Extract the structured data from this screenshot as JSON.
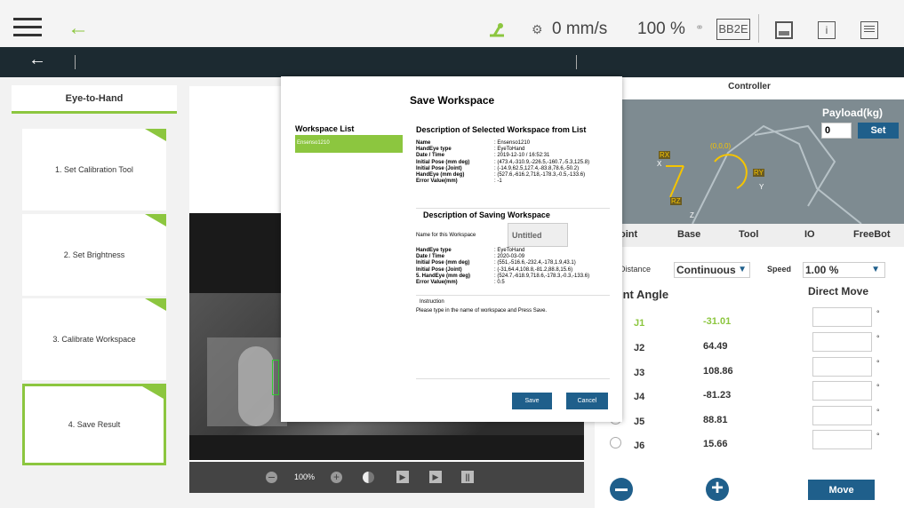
{
  "topbar": {
    "speed": "0 mm/s",
    "percent": "100 %",
    "badge": "BB2E"
  },
  "left_panel": {
    "tab": "Eye-to-Hand",
    "steps": [
      "1. Set Calibration Tool",
      "2. Set Brightness",
      "3. Calibrate Workspace",
      "4. Save Result"
    ]
  },
  "camera": {
    "zoom": "100%"
  },
  "modal": {
    "title": "Save Workspace",
    "list_title": "Workspace List",
    "list_items": [
      "Ensenso1210"
    ],
    "desc_title": "Description of Selected Workspace from List",
    "selected_labels": [
      "Name",
      "HandEye type",
      "Date / Time",
      "Initial Pose (mm deg)",
      "Initial Pose (Joint)",
      "HandEye (mm deg)",
      "Error Value(mm)"
    ],
    "selected_values": [
      ": Ensenso1210",
      ": EyeToHand",
      ": 2019-12-10 / 16:52:31",
      ": (473.4,-310.9,-226.5,-160.7,-5.3,125.8)",
      ": (-14.9,62.5,127.4,-83.8,78.6,-50.2)",
      ": (527.6,-616.2,718,-178.3,-0.5,-133.6)",
      ": -1"
    ],
    "saving_title": "Description of Saving Workspace",
    "name_label": "Name for this Workspace",
    "name_value": "Untitled",
    "saving_labels": [
      "HandEye type",
      "Date / Time",
      "Initial Pose (mm deg)",
      "Initial Pose (Joint)",
      "5. HandEye (mm deg)",
      "Error Value(mm)"
    ],
    "saving_values": [
      ": EyeToHand",
      ": 2020-03-09",
      ": (551,-516.6,-232.4,-178,1.9,43.1)",
      ": (-31,64.4,108.8,-81.2,88.8,15.6)",
      ": (524.7,-618.9,718.6,-178.3,-0.3,-133.6)",
      ": 0.5"
    ],
    "instruction_title": "Instruction",
    "instruction_text": "Please type in the name of workspace and Press Save.",
    "save": "Save",
    "cancel": "Cancel"
  },
  "controller": {
    "title": "Controller",
    "payload_label": "Payload(kg)",
    "payload_value": "0",
    "set": "Set",
    "labels": {
      "rx": "RX",
      "ry": "RY",
      "rz": "RZ",
      "x": "X",
      "y": "Y",
      "z": "Z",
      "origin": "(0,0,0)"
    },
    "tabs": [
      "oint",
      "Base",
      "Tool",
      "IO",
      "FreeBot"
    ],
    "distance_label": "Distance",
    "distance_value": "Continuous",
    "speed_label": "Speed",
    "speed_value": "1.00 %",
    "joint_angle": "int Angle",
    "direct_move": "Direct Move",
    "joints": [
      {
        "name": "J1",
        "value": "-31.01"
      },
      {
        "name": "J2",
        "value": "64.49"
      },
      {
        "name": "J3",
        "value": "108.86"
      },
      {
        "name": "J4",
        "value": "-81.23"
      },
      {
        "name": "J5",
        "value": "88.81"
      },
      {
        "name": "J6",
        "value": "15.66"
      }
    ],
    "deg": "°",
    "move": "Move"
  },
  "colors": {
    "accent": "#8cc63f",
    "blue": "#1f5f8b",
    "dark": "#1c2a31"
  }
}
